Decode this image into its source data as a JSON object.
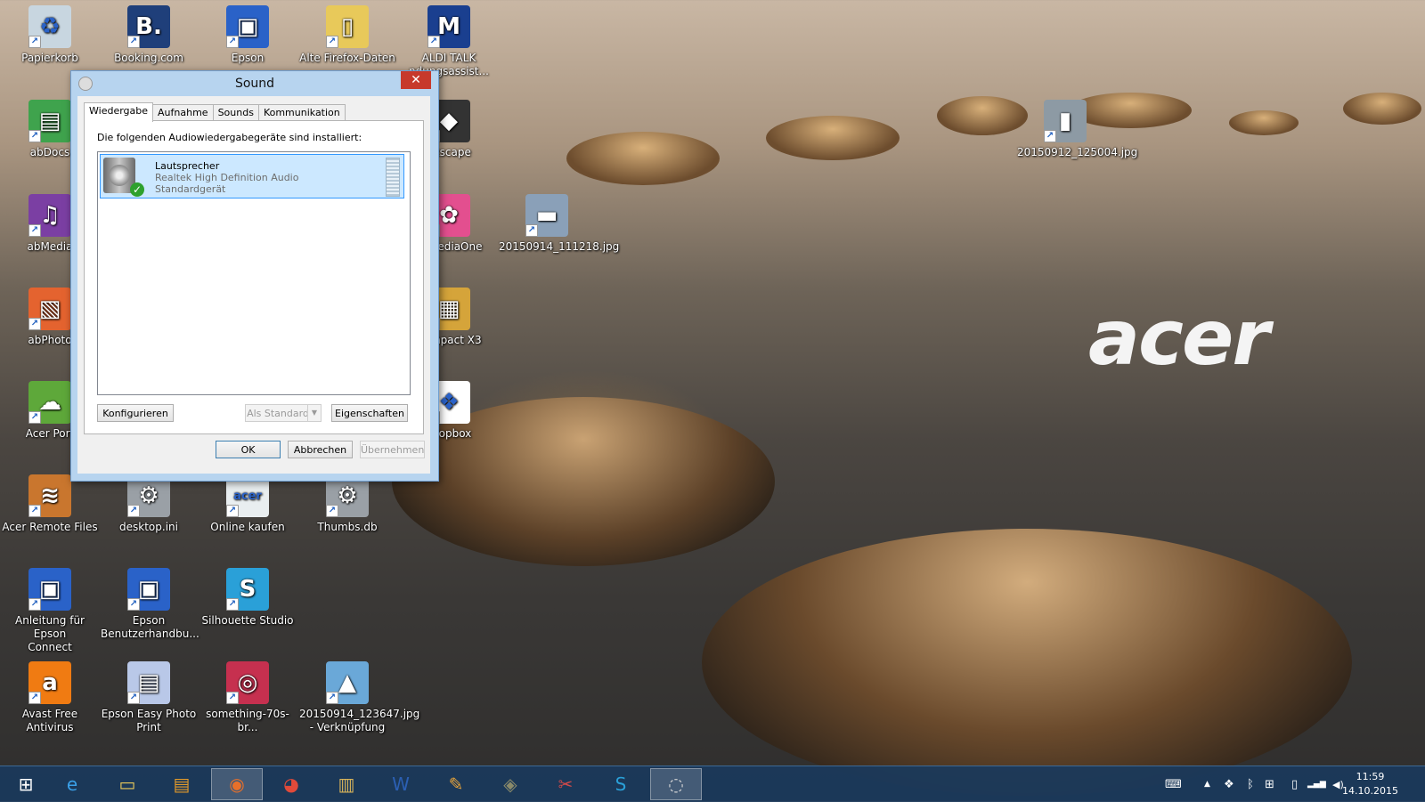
{
  "desktop": {
    "brand_logo": "acer",
    "icons": [
      {
        "label": "Papierkorb",
        "icon": "recycle-bin-icon",
        "color": "#c8d6e0",
        "glyph": "♻"
      },
      {
        "label": "Booking.com",
        "icon": "booking-icon",
        "color": "#1f3f7a",
        "glyph": "B."
      },
      {
        "label": "Epson",
        "icon": "epson-monitor-icon",
        "color": "#2a62c8",
        "glyph": "▣"
      },
      {
        "label": "Alte Firefox-Daten",
        "icon": "folder-icon",
        "color": "#e8c95a",
        "glyph": "▯"
      },
      {
        "label": "ALDI TALK\nndungsassist...",
        "icon": "aldi-talk-icon",
        "color": "#1a3f8f",
        "glyph": "M"
      },
      {
        "label": "abDocs",
        "icon": "docs-icon",
        "color": "#3fa34d",
        "glyph": "▤"
      },
      {
        "label": "nkscape",
        "icon": "inkscape-icon",
        "color": "#333333",
        "glyph": "◆"
      },
      {
        "label": "20150912_125004.jpg",
        "icon": "jpg-thumbnail-icon",
        "color": "#8d9aa4",
        "glyph": "▮"
      },
      {
        "label": "abMedia",
        "icon": "media-icon",
        "color": "#7b3fa3",
        "glyph": "♫"
      },
      {
        "label": "el MediaOne",
        "icon": "mediaone-icon",
        "color": "#e34f8f",
        "glyph": "✿"
      },
      {
        "label": "20150914_111218.jpg",
        "icon": "jpg-thumbnail-icon",
        "color": "#8aa0b8",
        "glyph": "▬"
      },
      {
        "label": "abPhoto",
        "icon": "photo-icon",
        "color": "#e4632f",
        "glyph": "▧"
      },
      {
        "label": "toImpact X3",
        "icon": "photoimpact-icon",
        "color": "#d5a43a",
        "glyph": "▦"
      },
      {
        "label": "Acer Port",
        "icon": "acer-portal-icon",
        "color": "#5ea83a",
        "glyph": "☁"
      },
      {
        "label": "Dropbox",
        "icon": "dropbox-icon",
        "color": "#ffffff",
        "glyph": "❖"
      },
      {
        "label": "Acer Remote Files",
        "icon": "remote-files-icon",
        "color": "#c9762e",
        "glyph": "≋"
      },
      {
        "label": "desktop.ini",
        "icon": "settings-file-icon",
        "color": "#9aa0a6",
        "glyph": "⚙"
      },
      {
        "label": "Online kaufen",
        "icon": "acer-store-icon",
        "color": "#e9eef0",
        "glyph": "acer"
      },
      {
        "label": "Thumbs.db",
        "icon": "settings-file-icon",
        "color": "#9aa0a6",
        "glyph": "⚙"
      },
      {
        "label": "Anleitung für Epson\nConnect",
        "icon": "epson-monitor-icon",
        "color": "#2a62c8",
        "glyph": "▣"
      },
      {
        "label": "Epson\nBenutzerhandbu...",
        "icon": "epson-monitor-icon",
        "color": "#2a62c8",
        "glyph": "▣"
      },
      {
        "label": "Silhouette Studio",
        "icon": "silhouette-icon",
        "color": "#2aa0d8",
        "glyph": "S"
      },
      {
        "label": "Avast Free Antivirus",
        "icon": "avast-icon",
        "color": "#f07b12",
        "glyph": "a"
      },
      {
        "label": "Epson Easy Photo\nPrint",
        "icon": "photo-print-icon",
        "color": "#b9c8e8",
        "glyph": "▤"
      },
      {
        "label": "something-70s-br...",
        "icon": "pattern-image-icon",
        "color": "#c6304f",
        "glyph": "◎"
      },
      {
        "label": "20150914_123647.jpg\n- Verknüpfung",
        "icon": "image-shortcut-icon",
        "color": "#6aa8d8",
        "glyph": "▲"
      }
    ]
  },
  "dialog": {
    "title": "Sound",
    "close_glyph": "✕",
    "tabs": [
      "Wiedergabe",
      "Aufnahme",
      "Sounds",
      "Kommunikation"
    ],
    "instruction": "Die folgenden Audiowiedergabegeräte sind installiert:",
    "device": {
      "name": "Lautsprecher",
      "driver": "Realtek High Definition Audio",
      "status": "Standardgerät"
    },
    "buttons": {
      "configure": "Konfigurieren",
      "set_default": "Als Standard",
      "properties": "Eigenschaften",
      "ok": "OK",
      "cancel": "Abbrechen",
      "apply": "Übernehmen"
    }
  },
  "taskbar": {
    "items": [
      {
        "name": "start-button",
        "glyph": "⊞",
        "color": "#ffffff"
      },
      {
        "name": "internet-explorer",
        "glyph": "e",
        "color": "#3aa0e8"
      },
      {
        "name": "file-explorer",
        "glyph": "▭",
        "color": "#e8c95a"
      },
      {
        "name": "notes-app",
        "glyph": "▤",
        "color": "#e39a2a"
      },
      {
        "name": "firefox",
        "glyph": "◉",
        "color": "#e8702a"
      },
      {
        "name": "chrome",
        "glyph": "◕",
        "color": "#e04a3a"
      },
      {
        "name": "photo-viewer",
        "glyph": "▥",
        "color": "#d8b45a"
      },
      {
        "name": "word",
        "glyph": "W",
        "color": "#2b5fb3"
      },
      {
        "name": "paint",
        "glyph": "✎",
        "color": "#e8a43a"
      },
      {
        "name": "gimp",
        "glyph": "◈",
        "color": "#8a8a6a"
      },
      {
        "name": "snipping-tool",
        "glyph": "✂",
        "color": "#d04a4a"
      },
      {
        "name": "silhouette-studio",
        "glyph": "S",
        "color": "#2aa0d8"
      },
      {
        "name": "sound-settings",
        "glyph": "◌",
        "color": "#d8d8d8"
      }
    ],
    "tray": {
      "keyboard_glyph": "⌨",
      "chevron_glyph": "▲",
      "dropbox_glyph": "❖",
      "bluetooth_glyph": "ᛒ",
      "windows_glyph": "⊞",
      "battery_glyph": "▯",
      "signal_glyph": "▂▄▆",
      "volume_glyph": "◀)"
    },
    "clock": {
      "time": "11:59",
      "date": "14.10.2015"
    }
  }
}
